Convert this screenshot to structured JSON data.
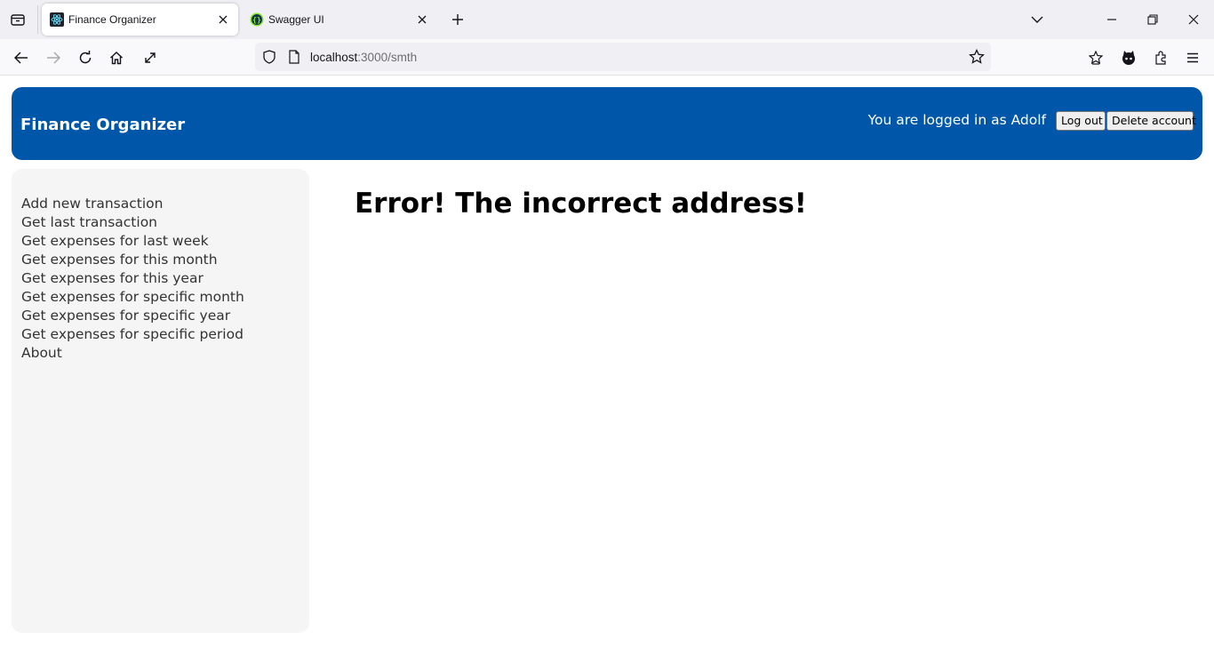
{
  "browser": {
    "tabs": [
      {
        "title": "Finance Organizer",
        "favicon": "react-icon",
        "active": true
      },
      {
        "title": "Swagger UI",
        "favicon": "swagger-icon",
        "active": false
      }
    ],
    "url": {
      "host": "localhost",
      "path": ":3000/smth"
    }
  },
  "header": {
    "app_title": "Finance Organizer",
    "login_text": "You are logged in as Adolf",
    "logout_label": "Log out",
    "delete_label": "Delete account",
    "bg_color": "#0056a8"
  },
  "sidebar": {
    "items": [
      {
        "label": "Add new transaction"
      },
      {
        "label": "Get last transaction"
      },
      {
        "label": "Get expenses for last week"
      },
      {
        "label": "Get expenses for this month"
      },
      {
        "label": "Get expenses for this year"
      },
      {
        "label": "Get expenses for specific month"
      },
      {
        "label": "Get expenses for specific year"
      },
      {
        "label": "Get expenses for specific period"
      },
      {
        "label": "About"
      }
    ]
  },
  "main": {
    "error_heading": "Error! The incorrect address!"
  }
}
